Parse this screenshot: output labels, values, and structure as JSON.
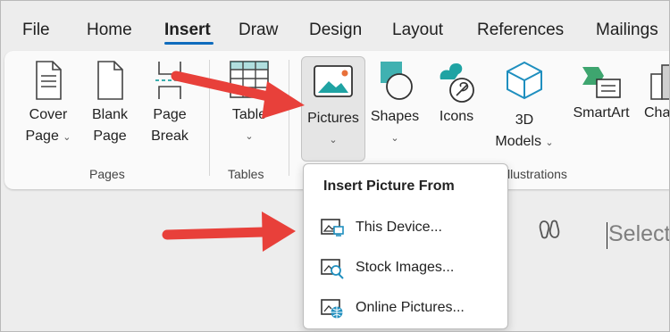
{
  "menu": {
    "tabs": [
      "File",
      "Home",
      "Insert",
      "Draw",
      "Design",
      "Layout",
      "References",
      "Mailings"
    ],
    "active_tab": "Insert"
  },
  "ribbon": {
    "cover_page": [
      "Cover",
      "Page"
    ],
    "blank_page": [
      "Blank",
      "Page"
    ],
    "page_break": [
      "Page",
      "Break"
    ],
    "table": "Table",
    "pictures": "Pictures",
    "shapes": "Shapes",
    "icons": "Icons",
    "models_3d": [
      "3D",
      "Models"
    ],
    "smartart": "SmartArt",
    "chart": "Cha",
    "groups": {
      "pages": "Pages",
      "tables": "Tables",
      "illustrations": "llustrations"
    }
  },
  "dropdown": {
    "title": "Insert Picture From",
    "items": [
      {
        "label": "This Device...",
        "icon": "device-picture-icon"
      },
      {
        "label": "Stock Images...",
        "icon": "stock-images-icon"
      },
      {
        "label": "Online Pictures...",
        "icon": "online-pictures-icon"
      }
    ]
  },
  "document": {
    "placeholder": "Select"
  },
  "colors": {
    "accent": "#0f6cbd",
    "arrow": "#e8403a",
    "teal": "#1fa3a3",
    "green": "#3ea56f"
  }
}
